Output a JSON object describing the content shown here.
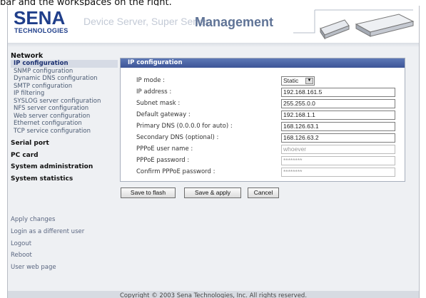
{
  "top_caption": "bar and the workspaces on the right.",
  "header": {
    "logo": "SENA",
    "logo_sub": "TECHNOLOGIES",
    "subtitle": "Device Server, Super Series",
    "title": "Management"
  },
  "sidebar": {
    "network_label": "Network",
    "network_items": [
      "IP configuration",
      "SNMP configuration",
      "Dynamic DNS configuration",
      "SMTP configuration",
      "IP filtering",
      "SYSLOG server configuration",
      "NFS server configuration",
      "Web server configuration",
      "Ethernet configuration",
      "TCP service configuration"
    ],
    "groups": [
      "Serial port",
      "PC card",
      "System administration",
      "System statistics"
    ],
    "actions": [
      "Apply changes",
      "Login as a different user",
      "Logout",
      "Reboot",
      "User web page"
    ]
  },
  "panel": {
    "title": "IP configuration",
    "fields": [
      {
        "label": "IP mode :",
        "value": "Static"
      },
      {
        "label": "IP address :",
        "value": "192.168.161.5"
      },
      {
        "label": "Subnet mask :",
        "value": "255.255.0.0"
      },
      {
        "label": "Default gateway :",
        "value": "192.168.1.1"
      },
      {
        "label": "Primary DNS (0.0.0.0 for auto) :",
        "value": "168.126.63.1"
      },
      {
        "label": "Secondary DNS (optional) :",
        "value": "168.126.63.2"
      },
      {
        "label": "PPPoE user name :",
        "value": "whoever"
      },
      {
        "label": "PPPoE password :",
        "value": "********"
      },
      {
        "label": "Confirm PPPoE password :",
        "value": "********"
      }
    ]
  },
  "buttons": {
    "save_flash": "Save to flash",
    "save_apply": "Save & apply",
    "cancel": "Cancel"
  },
  "footer": "Copyright © 2003 Sena Technologies, Inc. All rights reserved.",
  "icons": {
    "select_arrow": "dropdown-arrow-icon"
  },
  "colors": {
    "brand": "#1f3e8a",
    "panel_header": "#3d5597",
    "accent": "#5f7396"
  }
}
